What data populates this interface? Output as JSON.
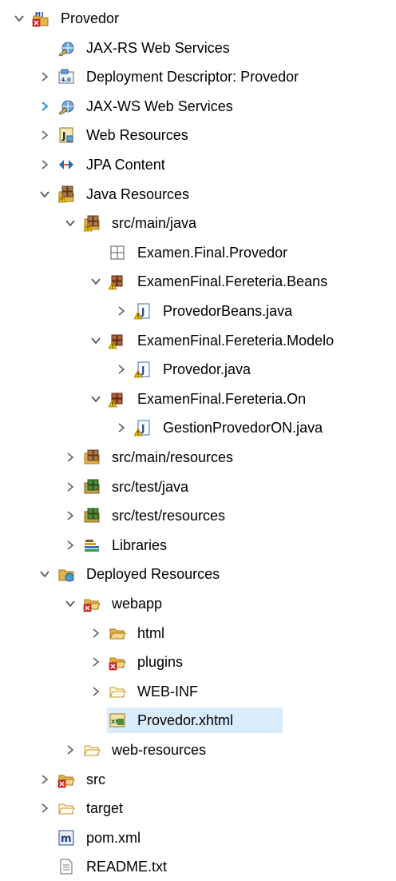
{
  "tree": {
    "items": [
      {
        "label": "Provedor",
        "level": 0,
        "toggle": "expanded",
        "icon": "maven-project-icon"
      },
      {
        "label": "JAX-RS Web Services",
        "level": 1,
        "toggle": "none",
        "icon": "web-services-icon"
      },
      {
        "label": "Deployment Descriptor: Provedor",
        "level": 1,
        "toggle": "collapsed",
        "icon": "deployment-descriptor-icon"
      },
      {
        "label": "JAX-WS Web Services",
        "level": 1,
        "toggle": "collapsed-blue",
        "icon": "web-services-icon"
      },
      {
        "label": "Web Resources",
        "level": 1,
        "toggle": "collapsed",
        "icon": "web-resources-icon"
      },
      {
        "label": "JPA Content",
        "level": 1,
        "toggle": "collapsed",
        "icon": "jpa-icon"
      },
      {
        "label": "Java Resources",
        "level": 1,
        "toggle": "expanded",
        "icon": "java-resources-warning-icon"
      },
      {
        "label": "src/main/java",
        "level": 2,
        "toggle": "expanded",
        "icon": "source-folder-warning-icon"
      },
      {
        "label": "Examen.Final.Provedor",
        "level": 3,
        "toggle": "none",
        "icon": "empty-package-icon"
      },
      {
        "label": "ExamenFinal.Fereteria.Beans",
        "level": 3,
        "toggle": "expanded",
        "icon": "package-warning-icon"
      },
      {
        "label": "ProvedorBeans.java",
        "level": 4,
        "toggle": "collapsed",
        "icon": "java-file-warning-icon"
      },
      {
        "label": "ExamenFinal.Fereteria.Modelo",
        "level": 3,
        "toggle": "expanded",
        "icon": "package-warning-icon"
      },
      {
        "label": "Provedor.java",
        "level": 4,
        "toggle": "collapsed",
        "icon": "java-file-warning-icon"
      },
      {
        "label": "ExamenFinal.Fereteria.On",
        "level": 3,
        "toggle": "expanded",
        "icon": "package-warning-icon"
      },
      {
        "label": "GestionProvedorON.java",
        "level": 4,
        "toggle": "collapsed",
        "icon": "java-file-warning-icon"
      },
      {
        "label": "src/main/resources",
        "level": 2,
        "toggle": "collapsed",
        "icon": "source-folder-icon"
      },
      {
        "label": "src/test/java",
        "level": 2,
        "toggle": "collapsed",
        "icon": "test-source-folder-icon"
      },
      {
        "label": "src/test/resources",
        "level": 2,
        "toggle": "collapsed",
        "icon": "test-source-folder-icon"
      },
      {
        "label": "Libraries",
        "level": 2,
        "toggle": "collapsed",
        "icon": "libraries-icon"
      },
      {
        "label": "Deployed Resources",
        "level": 1,
        "toggle": "expanded",
        "icon": "deployed-resources-icon"
      },
      {
        "label": "webapp",
        "level": 2,
        "toggle": "expanded",
        "icon": "folder-error-icon"
      },
      {
        "label": "html",
        "level": 3,
        "toggle": "collapsed",
        "icon": "folder-open-icon"
      },
      {
        "label": "plugins",
        "level": 3,
        "toggle": "collapsed",
        "icon": "folder-error-icon"
      },
      {
        "label": "WEB-INF",
        "level": 3,
        "toggle": "collapsed",
        "icon": "folder-open-outline-icon"
      },
      {
        "label": "Provedor.xhtml",
        "level": 3,
        "toggle": "none",
        "icon": "xhtml-file-icon",
        "selected": true
      },
      {
        "label": "web-resources",
        "level": 2,
        "toggle": "collapsed",
        "icon": "folder-open-outline-icon"
      },
      {
        "label": "src",
        "level": 1,
        "toggle": "collapsed",
        "icon": "folder-error-icon"
      },
      {
        "label": "target",
        "level": 1,
        "toggle": "collapsed",
        "icon": "folder-open-outline-icon"
      },
      {
        "label": "pom.xml",
        "level": 1,
        "toggle": "none",
        "icon": "maven-pom-icon"
      },
      {
        "label": "README.txt",
        "level": 1,
        "toggle": "none",
        "icon": "text-file-icon"
      }
    ]
  },
  "colors": {
    "selection": "#d9ecfb",
    "toggle": "#5a5a5a",
    "toggle_blue": "#1e90d6",
    "folder": "#e6b34a",
    "warning": "#f2c200",
    "error": "#d92b2b"
  }
}
